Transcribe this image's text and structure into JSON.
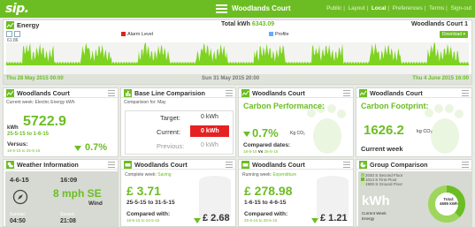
{
  "topbar": {
    "logo": "sip.",
    "site_title": "Woodlands Court",
    "nav": [
      "Public",
      "Layout",
      "Local",
      "Preferences",
      "Terms",
      "Sign-out"
    ],
    "active_nav": "Local"
  },
  "energy": {
    "title": "Energy",
    "total_label": "Total kWh",
    "total_value": "6343.09",
    "site": "Woodlands Court 1",
    "legend_alarm": "Alarm Level",
    "legend_profile": "Profile",
    "download": "Download ▾",
    "y_max": "61.86",
    "date_start": "Thu 28 May 2015 00:00",
    "date_mid": "Sun 31 May 2015 20:00",
    "date_end": "Thu 4 June 2015 16:00"
  },
  "panels": {
    "p1": {
      "title": "Woodlands Court",
      "sub": "Current week: Electric Energy kWh",
      "unit": "kWh",
      "value": "5722.9",
      "range": "25-5-15 to 1-6-15",
      "versus_label": "Versus:",
      "versus_range": "18-5-15 to 25-5-15",
      "change": "0.7%"
    },
    "p2": {
      "title": "Base Line Comparision",
      "sub": "Comparision for: May",
      "target_label": "Target:",
      "target_value": "0 kWh",
      "current_label": "Current:",
      "current_value": "0 kWh",
      "previous_label": "Previous:",
      "previous_value": "0 kWh"
    },
    "p3": {
      "title": "Woodlands Court",
      "heading": "Carbon Performance:",
      "change": "0.7%",
      "unit": "Kg CO₂",
      "compared_label": "Compared dates:",
      "compared_range_a": "18-5-15",
      "compared_vs": "Vs",
      "compared_range_b": "25-5-15"
    },
    "p4": {
      "title": "Woodlands Court",
      "heading": "Carbon Footprint:",
      "value": "1626.2",
      "unit": "kg CO₂",
      "period": "Current week"
    },
    "p5": {
      "title": "Weather Information",
      "date": "4-6-15",
      "time": "16:09",
      "wind": "8 mph SE",
      "wind_label": "Wind",
      "sunrise_label": "Sunrise:",
      "sunrise": "04:50",
      "sunset_label": "Sunset:",
      "sunset": "21:08"
    },
    "p6": {
      "title": "Woodlands Court",
      "sub_label": "Complete week:",
      "sub_value": "Saving",
      "value": "£ 3.71",
      "range": "25-5-15 to 31-5-15",
      "compared_label": "Compared with:",
      "compared_range": "18-5-15 to 24-5-15",
      "change": "£ 2.68"
    },
    "p7": {
      "title": "Woodlands Court",
      "sub_label": "Running week:",
      "sub_value": "Expenditure",
      "value": "£ 278.98",
      "range": "1-6-15 to 4-6-15",
      "compared_label": "Compared with:",
      "compared_range": "25-5-15 to 28-5-15",
      "change": "£ 1.21"
    },
    "p8": {
      "title": "Group Comparison",
      "legend": [
        "2040 S Second Floor",
        "1014 S First Floor",
        "1900 S Ground Floor"
      ],
      "total_label": "Total:",
      "total_value": "4695 kWh",
      "kwh_label": "kWh",
      "foot1": "Current Week",
      "foot2": "Energy"
    }
  },
  "colors": {
    "brand": "#6cbd23",
    "alarm": "#e52121",
    "profile": "#66aaff"
  }
}
